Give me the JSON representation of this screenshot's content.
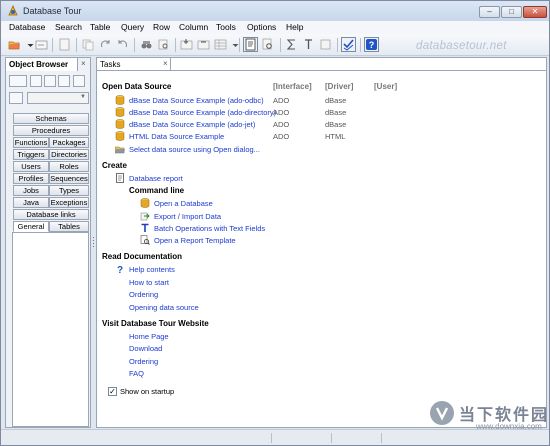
{
  "window": {
    "title": "Database Tour"
  },
  "menu": [
    "Database",
    "Search",
    "Table",
    "Query",
    "Row",
    "Column",
    "Tools",
    "Options",
    "Help"
  ],
  "watermark": "databasetour.net",
  "left_panel": {
    "tab_label": "Object Browser",
    "close": "×",
    "tabs": {
      "schemas": "Schemas",
      "procedures": "Procedures",
      "functions": "Functions",
      "packages": "Packages",
      "triggers": "Triggers",
      "directories": "Directories",
      "users": "Users",
      "roles": "Roles",
      "profiles": "Profiles",
      "sequences": "Sequences",
      "jobs": "Jobs",
      "types": "Types",
      "java": "Java",
      "exceptions": "Exceptions",
      "database_links": "Database links",
      "general": "General",
      "tables": "Tables"
    }
  },
  "main_panel": {
    "tab_label": "Tasks",
    "close": "×",
    "open_ds": {
      "title": "Open Data Source",
      "headers": {
        "interface": "[Interface]",
        "driver": "[Driver]",
        "user": "[User]"
      },
      "rows": [
        {
          "name": "dBase Data Source Example (ado-odbc)",
          "interface": "ADO",
          "driver": "dBase"
        },
        {
          "name": "dBase Data Source Example (ado-directory)",
          "interface": "ADO",
          "driver": "dBase"
        },
        {
          "name": "dBase Data Source Example (ado-jet)",
          "interface": "ADO",
          "driver": "dBase"
        },
        {
          "name": "HTML Data Source Example",
          "interface": "ADO",
          "driver": "HTML"
        }
      ],
      "select_link": "Select data source using Open dialog..."
    },
    "create": {
      "title": "Create",
      "database_report": "Database report",
      "command_line": "Command line",
      "cmd_items": {
        "open_db": "Open a Database",
        "export_import": "Export / Import Data",
        "batch": "Batch Operations with Text Fields",
        "report_template": "Open a Report Template"
      }
    },
    "read_docs": {
      "title": "Read Documentation",
      "help_contents": "Help contents",
      "how_to_start": "How to start",
      "ordering": "Ordering",
      "opening_ds": "Opening data source"
    },
    "visit": {
      "title": "Visit Database Tour Website",
      "home": "Home Page",
      "download": "Download",
      "ordering": "Ordering",
      "faq": "FAQ"
    },
    "show_on_startup": {
      "label": "Show on startup",
      "checked": true,
      "mark": "✓"
    }
  },
  "brand": {
    "name": "当下软件园",
    "url": "www.downxia.com"
  },
  "colors": {
    "link": "#1d3bd0",
    "chrome": "#dfe6f0"
  }
}
